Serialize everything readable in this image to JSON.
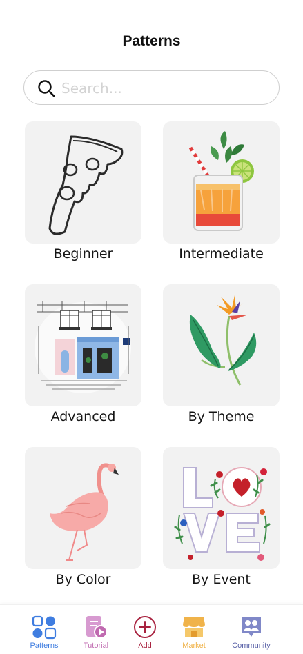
{
  "header": {
    "title": "Patterns"
  },
  "search": {
    "placeholder": "Search..."
  },
  "categories": [
    {
      "label": "Beginner"
    },
    {
      "label": "Intermediate"
    },
    {
      "label": "Advanced"
    },
    {
      "label": "By Theme"
    },
    {
      "label": "By Color"
    },
    {
      "label": "By Event"
    }
  ],
  "tabbar": {
    "items": [
      {
        "label": "Patterns",
        "icon": "grid-icon",
        "color": "#3f7de0",
        "active": true
      },
      {
        "label": "Tutorial",
        "icon": "tutorial-icon",
        "color": "#c06ab0"
      },
      {
        "label": "Add",
        "icon": "plus-circle-icon",
        "color": "#a8223f"
      },
      {
        "label": "Market",
        "icon": "store-icon",
        "color": "#f0b34a"
      },
      {
        "label": "Community",
        "icon": "community-icon",
        "color": "#5b63a8"
      }
    ]
  }
}
